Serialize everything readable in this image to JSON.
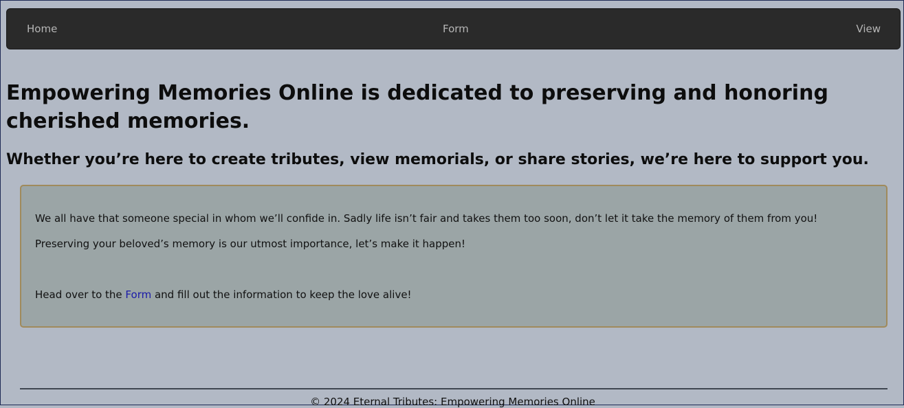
{
  "nav": {
    "home": "Home",
    "form": "Form",
    "view": "View"
  },
  "main": {
    "headline": "Empowering Memories Online is dedicated to preserving and honoring cherished memories.",
    "subheadline": "Whether you’re here to create tributes, view memorials, or share stories, we’re here to support you.",
    "paragraph_1": "We all have that someone special in whom we’ll confide in. Sadly life isn’t fair and takes them too soon, don’t let it take the memory of them from you!",
    "paragraph_2": "Preserving your beloved’s memory is our utmost importance, let’s make it happen!",
    "cta_prefix": "Head over to the ",
    "cta_link": "Form",
    "cta_suffix": " and fill out the information to keep the love alive!"
  },
  "footer": {
    "text": "© 2024 Eternal Tributes: Empowering Memories Online"
  },
  "colors": {
    "background": "#b2b9c5",
    "navbar": "#2a2a2a",
    "box": "#9ba5a6",
    "box_border": "#a08a5b",
    "link": "#1a1aa8"
  }
}
